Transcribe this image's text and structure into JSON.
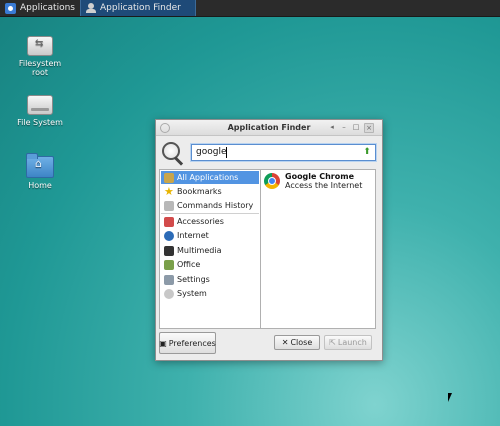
{
  "taskbar": {
    "applications_label": "Applications",
    "active_window_label": "Application Finder"
  },
  "desktop": {
    "icons": [
      {
        "label": "Filesystem\nroot",
        "icon": "usb-drive-icon"
      },
      {
        "label": "File System",
        "icon": "hard-drive-icon"
      },
      {
        "label": "Home",
        "icon": "home-folder-icon"
      }
    ]
  },
  "window": {
    "title": "Application Finder",
    "search": {
      "value": "google"
    },
    "categories": [
      {
        "label": "All Applications",
        "icon": "all-apps-icon",
        "selected": true
      },
      {
        "label": "Bookmarks",
        "icon": "star-icon"
      },
      {
        "label": "Commands History",
        "icon": "history-icon"
      },
      {
        "label": "Accessories",
        "icon": "accessories-icon"
      },
      {
        "label": "Internet",
        "icon": "globe-icon"
      },
      {
        "label": "Multimedia",
        "icon": "multimedia-icon"
      },
      {
        "label": "Office",
        "icon": "office-icon"
      },
      {
        "label": "Settings",
        "icon": "settings-icon"
      },
      {
        "label": "System",
        "icon": "system-icon"
      }
    ],
    "results": [
      {
        "name": "Google Chrome",
        "description": "Access the Internet",
        "icon": "chrome-icon"
      }
    ],
    "buttons": {
      "preferences": "Preferences",
      "close": "Close",
      "launch": "Launch"
    }
  },
  "colors": {
    "selection": "#5294e2",
    "taskbar": "#2b2b2b",
    "desktop_accent": "#1f9895"
  }
}
